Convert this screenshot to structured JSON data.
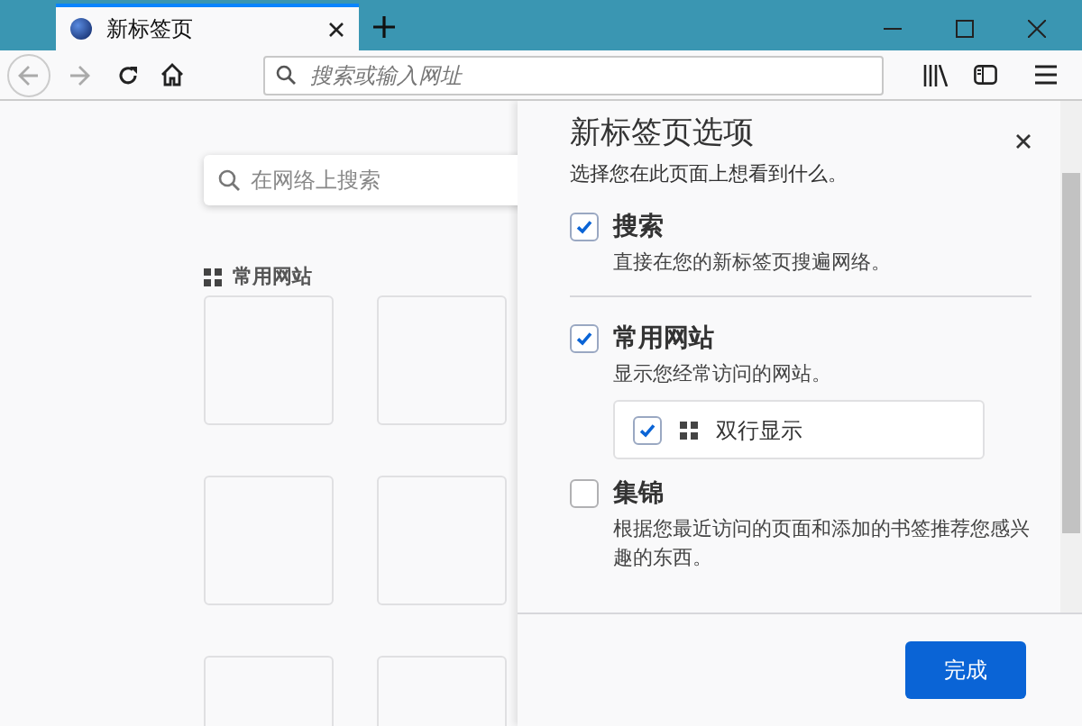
{
  "tab": {
    "title": "新标签页"
  },
  "address_bar": {
    "placeholder": "搜索或输入网址"
  },
  "page": {
    "search": {
      "placeholder": "在网络上搜索"
    },
    "top_sites": {
      "heading": "常用网站"
    }
  },
  "panel": {
    "title": "新标签页选项",
    "subtitle": "选择您在此页面上想看到什么。",
    "sections": [
      {
        "label": "搜索",
        "description": "直接在您的新标签页搜遍网络。",
        "checked": true
      },
      {
        "label": "常用网站",
        "description": "显示您经常访问的网站。",
        "checked": true,
        "option": {
          "label": "双行显示",
          "checked": true
        }
      },
      {
        "label": "集锦",
        "description": "根据您最近访问的页面和添加的书签推荐您感兴趣的东西。",
        "checked": false
      }
    ],
    "done_button": "完成"
  }
}
